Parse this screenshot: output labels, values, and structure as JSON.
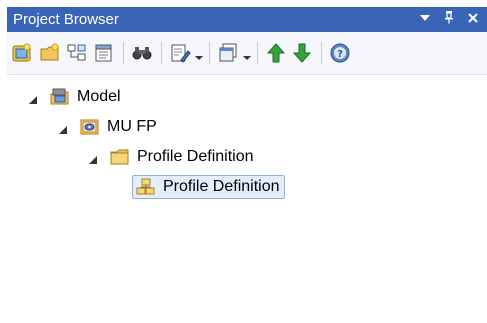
{
  "window": {
    "title": "Project Browser",
    "controls": {
      "dropdown": "▼",
      "pin": "↓",
      "close": "✕"
    }
  },
  "toolbar": {
    "buttons": [
      {
        "icon": "new-model-icon"
      },
      {
        "icon": "new-package-icon"
      },
      {
        "icon": "new-diagram-icon"
      },
      {
        "icon": "new-element-icon"
      },
      {
        "icon": "find-icon"
      },
      {
        "icon": "edit-icon"
      },
      {
        "icon": "window-icon"
      },
      {
        "icon": "move-up-icon"
      },
      {
        "icon": "move-down-icon"
      },
      {
        "icon": "help-icon"
      }
    ]
  },
  "tree": {
    "nodes": [
      {
        "label": "Model",
        "icon": "model-root-icon",
        "expanded": true
      },
      {
        "label": "MU FP",
        "icon": "view-package-icon",
        "expanded": true
      },
      {
        "label": "Profile Definition",
        "icon": "folder-icon",
        "expanded": true
      },
      {
        "label": "Profile Definition",
        "icon": "profile-diagram-icon",
        "selected": true
      }
    ]
  }
}
